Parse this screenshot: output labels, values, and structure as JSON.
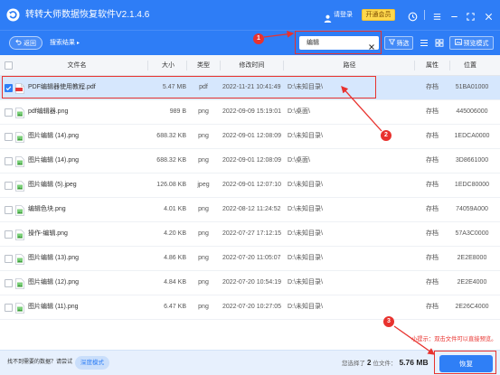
{
  "app": {
    "title": "转转大师数据恢复软件V2.1.4.6",
    "login": "请登录",
    "vip": "开通会员"
  },
  "toolbar": {
    "back": "返回",
    "breadcrumb": "搜索结果",
    "breadcrumb_arrow": "▸",
    "search_value": "编辑",
    "filter": "筛选",
    "preview_mode": "预览模式"
  },
  "table": {
    "headers": {
      "name": "文件名",
      "size": "大小",
      "type": "类型",
      "mtime": "修改时间",
      "path": "路径",
      "attr": "属性",
      "location": "位置"
    },
    "rows": [
      {
        "name": "PDF编辑器使用教程.pdf",
        "size": "5.47 MB",
        "type": "pdf",
        "mtime": "2022-11-21 10:41:49",
        "path": "D:\\未知目录\\",
        "attr": "存档",
        "location": "51BA01000",
        "icon": "pdf-icon",
        "checked": true
      },
      {
        "name": "pdf编辑器.png",
        "size": "989 B",
        "type": "png",
        "mtime": "2022-09-09 15:19:01",
        "path": "D:\\桌面\\",
        "attr": "存档",
        "location": "445006000",
        "icon": "image-icon",
        "checked": false
      },
      {
        "name": "图片编辑 (14).png",
        "size": "688.32 KB",
        "type": "png",
        "mtime": "2022-09-01 12:08:09",
        "path": "D:\\未知目录\\",
        "attr": "存档",
        "location": "1EDCA0000",
        "icon": "image-icon",
        "checked": false
      },
      {
        "name": "图片编辑 (14).png",
        "size": "688.32 KB",
        "type": "png",
        "mtime": "2022-09-01 12:08:09",
        "path": "D:\\桌面\\",
        "attr": "存档",
        "location": "3D8661000",
        "icon": "image-icon",
        "checked": false
      },
      {
        "name": "图片编辑 (5).jpeg",
        "size": "126.08 KB",
        "type": "jpeg",
        "mtime": "2022-09-01 12:07:10",
        "path": "D:\\未知目录\\",
        "attr": "存档",
        "location": "1EDC80000",
        "icon": "image-icon",
        "checked": false
      },
      {
        "name": "编辑色块.png",
        "size": "4.01 KB",
        "type": "png",
        "mtime": "2022-08-12 11:24:52",
        "path": "D:\\未知目录\\",
        "attr": "存档",
        "location": "74059A000",
        "icon": "image-icon",
        "checked": false
      },
      {
        "name": "操作-编辑.png",
        "size": "4.20 KB",
        "type": "png",
        "mtime": "2022-07-27 17:12:15",
        "path": "D:\\未知目录\\",
        "attr": "存档",
        "location": "57A3C0000",
        "icon": "image-icon",
        "checked": false
      },
      {
        "name": "图片编辑 (13).png",
        "size": "4.86 KB",
        "type": "png",
        "mtime": "2022-07-20 11:05:07",
        "path": "D:\\未知目录\\",
        "attr": "存档",
        "location": "2E2E8000",
        "icon": "image-icon",
        "checked": false
      },
      {
        "name": "图片编辑 (12).png",
        "size": "4.84 KB",
        "type": "png",
        "mtime": "2022-07-20 10:54:19",
        "path": "D:\\未知目录\\",
        "attr": "存档",
        "location": "2E2E4000",
        "icon": "image-icon",
        "checked": false
      },
      {
        "name": "图片编辑 (11).png",
        "size": "6.47 KB",
        "type": "png",
        "mtime": "2022-07-20 10:27:05",
        "path": "D:\\未知目录\\",
        "attr": "存档",
        "location": "2E26C4000",
        "icon": "image-icon",
        "checked": false
      }
    ]
  },
  "footer": {
    "hint": "找不到需要的数据？请尝试",
    "deep_mode": "深度模式",
    "selected_prefix": "您选择了",
    "selected_count": "2",
    "selected_suffix": "位文件：",
    "selected_size": "5.76 MB",
    "recover": "恢复"
  },
  "annotations": {
    "step1": "1",
    "step2": "2",
    "step3": "3",
    "tip": "小提示：双击文件可以直接预览。"
  },
  "colors": {
    "brand": "#2e7df6",
    "vip": "#ffd84d",
    "annotation": "#e8322e",
    "selected_row": "#d6e7fd",
    "footer_bg": "#e7f0fd"
  }
}
